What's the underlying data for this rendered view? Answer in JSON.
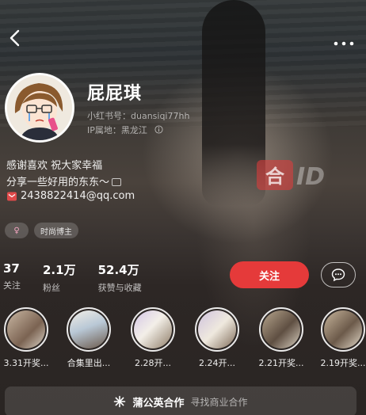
{
  "profile": {
    "name": "屁屁琪",
    "red_id": "小红书号：duansiqi77hh",
    "ip": "IP属地：黑龙江",
    "bio_line1": "感谢喜欢 祝大家幸福",
    "bio_line2": "分享一些好用的东东～",
    "email": "2438822414@qq.com",
    "tags": [
      "♀",
      "时尚博主"
    ]
  },
  "watermark": "合ID",
  "stats": [
    {
      "value": "37",
      "label": "关注"
    },
    {
      "value": "2.1万",
      "label": "粉丝"
    },
    {
      "value": "52.4万",
      "label": "获赞与收藏"
    }
  ],
  "actions": {
    "follow": "关注"
  },
  "stories": [
    {
      "label": "3.31开奖..."
    },
    {
      "label": "合集里出..."
    },
    {
      "label": "2.28开..."
    },
    {
      "label": "2.24开..."
    },
    {
      "label": "2.21开奖..."
    },
    {
      "label": "2.19开奖..."
    }
  ],
  "bottom_bar": {
    "title": "蒲公英合作",
    "subtitle": "寻找商业合作"
  },
  "colors": {
    "follow": "#e53a3a"
  },
  "icons": {
    "back": "back-arrow-icon",
    "more": "more-dots-icon",
    "chat": "chat-bubble-icon",
    "mail": "mail-icon",
    "dandelion": "dandelion-icon",
    "info": "info-icon"
  }
}
